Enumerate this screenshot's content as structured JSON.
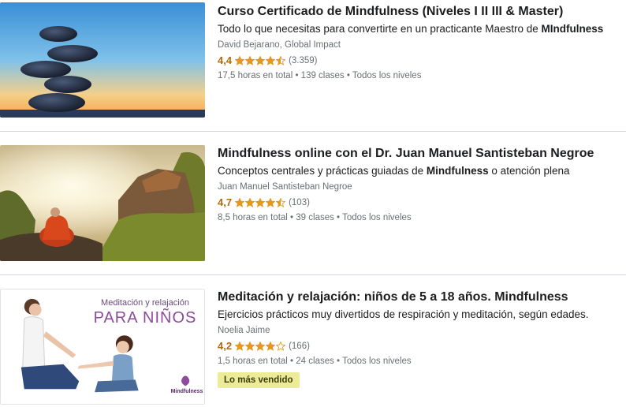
{
  "courses": [
    {
      "title": "Curso Certificado de Mindfulness (Niveles I II III & Master)",
      "desc_before": "Todo lo que necesitas para convertirte en un practicante Maestro de ",
      "desc_bold": "MIndfulness",
      "desc_after": "",
      "author": "David Bejarano, Global Impact",
      "rating": "4,4",
      "stars": 4.5,
      "reviews": "(3.359)",
      "meta": "17,5 horas en total • 139 clases • Todos los niveles",
      "thumb_icon": "stacked-stones-image"
    },
    {
      "title": "Mindfulness online con el Dr. Juan Manuel Santisteban Negroe",
      "desc_before": "Conceptos centrales y prácticas guiadas de ",
      "desc_bold": "Mindfulness",
      "desc_after": " o atención plena",
      "author": "Juan Manuel Santisteban Negroe",
      "rating": "4,7",
      "stars": 4.5,
      "reviews": "(103)",
      "meta": "8,5 horas en total • 39 clases • Todos los niveles",
      "thumb_icon": "monk-meditating-image"
    },
    {
      "title": "Meditación y relajación: niños de 5 a 18 años. Mindfulness",
      "desc_before": "Ejercicios prácticos muy divertidos de respiración y meditación, según edades.",
      "desc_bold": "",
      "desc_after": "",
      "author": "Noelia Jaime",
      "rating": "4,2",
      "stars": 4,
      "reviews": "(166)",
      "meta": "1,5 horas en total • 24 clases • Todos los niveles",
      "badge": "Lo más vendido",
      "thumb_icon": "mother-child-image",
      "thumb_text_top": "Meditación y relajación",
      "thumb_text_big": "PARA NIÑOS",
      "thumb_logo": "Mindfulness"
    }
  ],
  "colors": {
    "rating": "#b4690e",
    "star": "#e59819",
    "badge_bg": "#eceb98",
    "thumb_title": "#8e4a9c"
  }
}
